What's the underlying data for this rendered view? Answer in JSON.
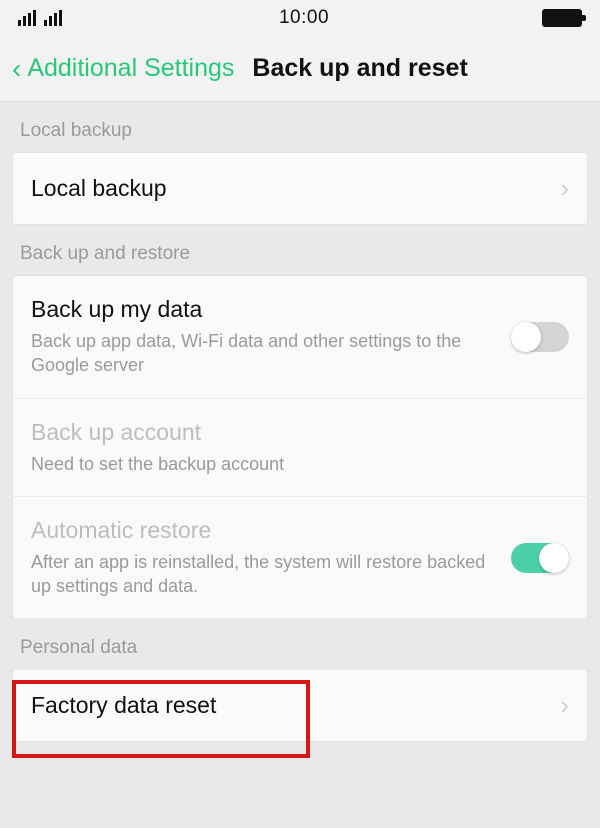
{
  "statusbar": {
    "time": "10:00"
  },
  "nav": {
    "back_label": "Additional Settings",
    "title": "Back up and reset"
  },
  "sections": {
    "local_backup": {
      "label": "Local backup",
      "items": {
        "local_backup": {
          "title": "Local backup"
        }
      }
    },
    "backup_restore": {
      "label": "Back up and restore",
      "items": {
        "backup_my_data": {
          "title": "Back up my data",
          "subtitle": "Back up app data, Wi-Fi data and other settings to the Google server",
          "toggle": "off"
        },
        "backup_account": {
          "title": "Back up account",
          "subtitle": "Need to set the backup account"
        },
        "automatic_restore": {
          "title": "Automatic restore",
          "subtitle": "After an app is reinstalled, the system will restore backed up settings and data.",
          "toggle": "on"
        }
      }
    },
    "personal_data": {
      "label": "Personal data",
      "items": {
        "factory_reset": {
          "title": "Factory data reset"
        }
      }
    }
  }
}
